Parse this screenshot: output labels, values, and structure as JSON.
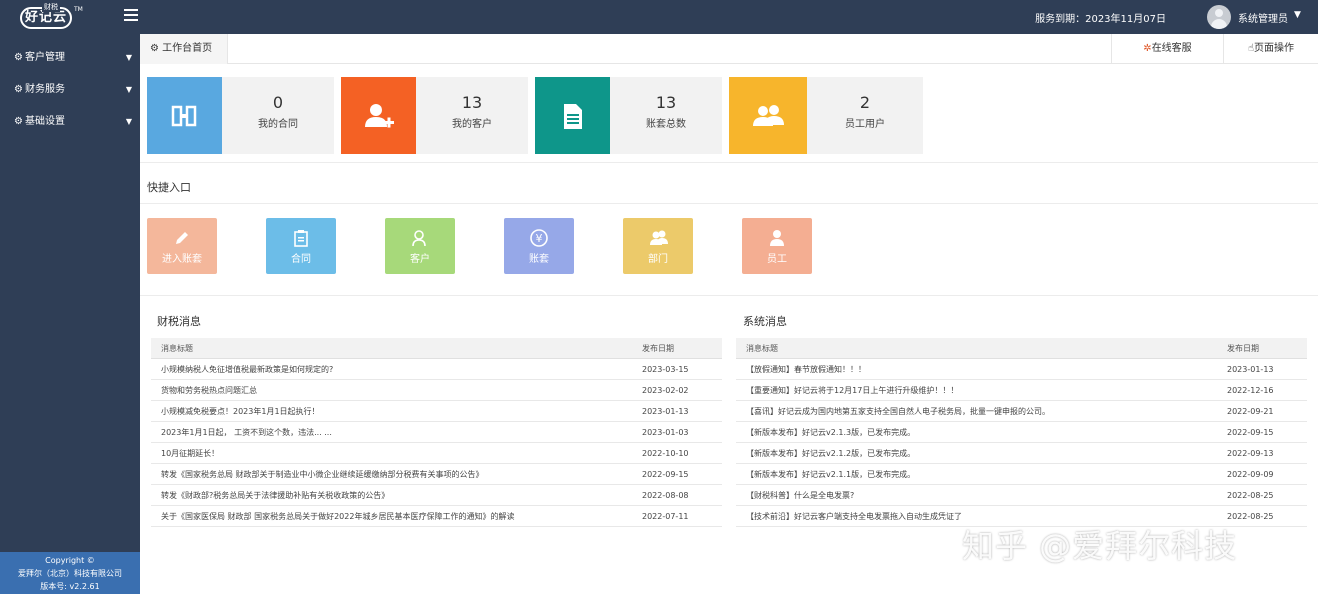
{
  "header": {
    "logo_text": "好记云",
    "logo_tag": "财税",
    "logo_tm": "TM",
    "service_label": "服务到期：",
    "service_date": "2023年11月07日",
    "username": "系统管理员"
  },
  "sidebar": {
    "items": [
      {
        "label": "客户管理"
      },
      {
        "label": "财务服务"
      },
      {
        "label": "基础设置"
      }
    ],
    "footer": {
      "copyright": "Copyright ©",
      "company": "爱拜尔（北京）科技有限公司",
      "version": "版本号: v2.2.61"
    }
  },
  "tabs": {
    "home": "工作台首页",
    "online": "在线客服",
    "page_ops": "页面操作"
  },
  "stats": [
    {
      "value": "0",
      "label": "我的合同",
      "color": "#59a8e0"
    },
    {
      "value": "13",
      "label": "我的客户",
      "color": "#f46124"
    },
    {
      "value": "13",
      "label": "账套总数",
      "color": "#0e968a"
    },
    {
      "value": "2",
      "label": "员工用户",
      "color": "#f7b52c"
    }
  ],
  "shortcuts": {
    "title": "快捷入口",
    "items": [
      {
        "label": "进入账套",
        "color": "#f4b79b"
      },
      {
        "label": "合同",
        "color": "#6cbde8"
      },
      {
        "label": "客户",
        "color": "#a7d97a"
      },
      {
        "label": "账套",
        "color": "#96a8e8"
      },
      {
        "label": "部门",
        "color": "#ecca6a"
      },
      {
        "label": "员工",
        "color": "#f4ae92"
      }
    ]
  },
  "tax_news": {
    "title": "财税消息",
    "col_title": "消息标题",
    "col_date": "发布日期",
    "rows": [
      {
        "title": "小规模纳税人免征增值税最新政策是如何规定的?",
        "date": "2023-03-15"
      },
      {
        "title": "货物和劳务税热点问题汇总",
        "date": "2023-02-02"
      },
      {
        "title": "小规模减免税要点！2023年1月1日起执行！",
        "date": "2023-01-13"
      },
      {
        "title": "2023年1月1日起， 工资不到这个数，违法... ...",
        "date": "2023-01-03"
      },
      {
        "title": "10月征期延长！",
        "date": "2022-10-10"
      },
      {
        "title": "转发《国家税务总局 财政部关于制造业中小微企业继续延缓缴纳部分税费有关事项的公告》",
        "date": "2022-09-15"
      },
      {
        "title": "转发《财政部?税务总局关于法律援助补贴有关税收政策的公告》",
        "date": "2022-08-08"
      },
      {
        "title": "关于《国家医保局 财政部 国家税务总局关于做好2022年城乡居民基本医疗保障工作的通知》的解读",
        "date": "2022-07-11"
      }
    ]
  },
  "sys_news": {
    "title": "系统消息",
    "col_title": "消息标题",
    "col_date": "发布日期",
    "rows": [
      {
        "title": "【放假通知】春节放假通知！！！",
        "date": "2023-01-13"
      },
      {
        "title": "【重要通知】好记云将于12月17日上午进行升级维护！！！",
        "date": "2022-12-16"
      },
      {
        "title": "【喜讯】好记云成为国内地第五家支持全国自然人电子税务局，批量一键申报的公司。",
        "date": "2022-09-21"
      },
      {
        "title": "【新版本发布】好记云v2.1.3版，已发布完成。",
        "date": "2022-09-15"
      },
      {
        "title": "【新版本发布】好记云v2.1.2版，已发布完成。",
        "date": "2022-09-13"
      },
      {
        "title": "【新版本发布】好记云v2.1.1版，已发布完成。",
        "date": "2022-09-09"
      },
      {
        "title": "【财税科普】什么是全电发票?",
        "date": "2022-08-25"
      },
      {
        "title": "【技术前沿】好记云客户端支持全电发票拖入自动生成凭证了",
        "date": "2022-08-25"
      }
    ]
  },
  "watermark": "知乎 @爱拜尔科技"
}
